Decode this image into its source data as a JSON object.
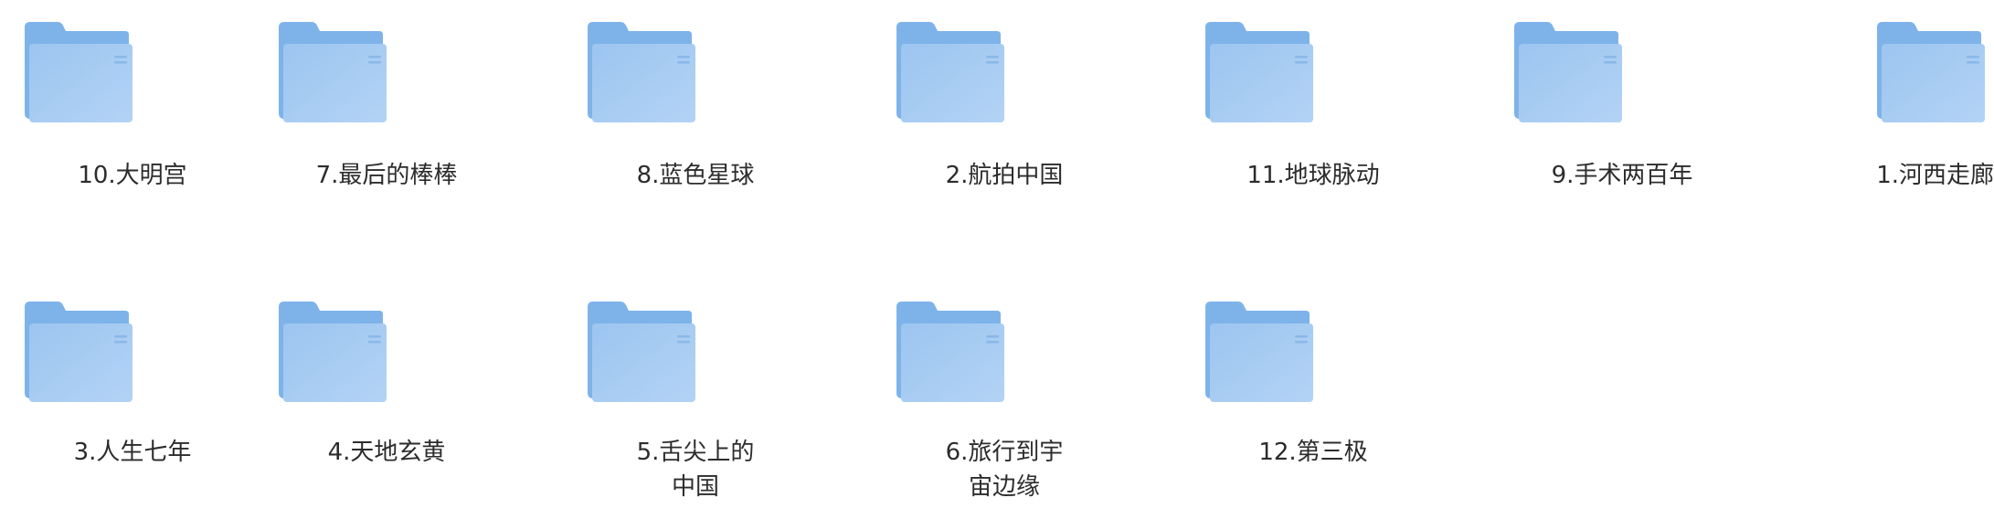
{
  "folders": [
    {
      "name": "10.大明宫"
    },
    {
      "name": "7.最后的棒棒"
    },
    {
      "name": "8.蓝色星球"
    },
    {
      "name": "2.航拍中国"
    },
    {
      "name": "11.地球脉动"
    },
    {
      "name": "9.手术两百年"
    },
    {
      "name": "1.河西走廊"
    },
    {
      "name": "3.人生七年"
    },
    {
      "name": "4.天地玄黄"
    },
    {
      "name": "5.舌尖上的中国"
    },
    {
      "name": "6.旅行到宇宙边缘"
    },
    {
      "name": "12.第三极"
    }
  ],
  "icon": "folder-icon",
  "colors": {
    "folder_back": "#7EB3EA",
    "folder_front": "#B3D3F5",
    "folder_front_dark": "#9CC5F0",
    "folder_line": "#8AB8E8",
    "label_text": "#2c2c2c"
  }
}
